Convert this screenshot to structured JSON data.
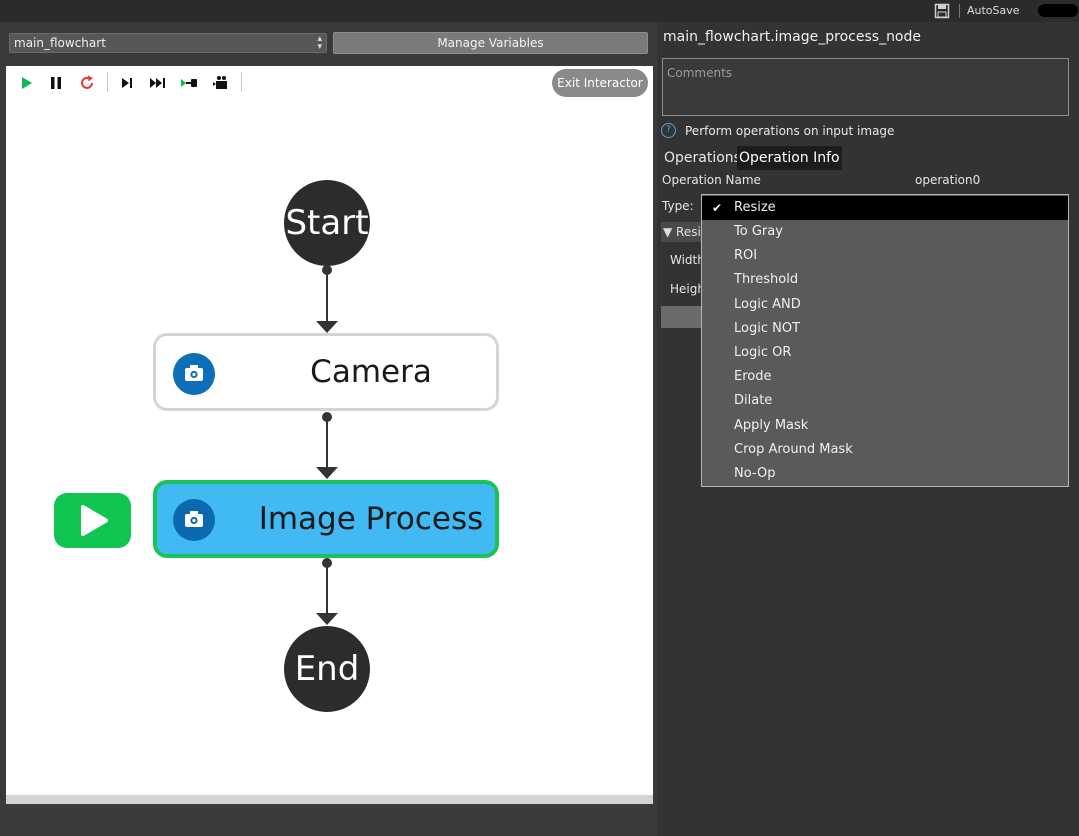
{
  "topbar": {
    "autosave_label": "AutoSave",
    "save_icon": "save-icon"
  },
  "flowchart_select": {
    "value": "main_flowchart"
  },
  "manage_variables_label": "Manage Variables",
  "toolbar": {
    "icons": [
      "play-icon",
      "pause-icon",
      "restart-icon",
      "step-icon",
      "fast-forward-icon",
      "run-to-node-icon",
      "camera-step-icon"
    ],
    "exit_label": "Exit Interactor"
  },
  "flow": {
    "start_label": "Start",
    "camera_label": "Camera",
    "process_label": "Image Process",
    "end_label": "End"
  },
  "colors": {
    "active_node_fill": "#41b9f2",
    "active_node_border": "#19c35a",
    "node_icon": "#0d6fb8",
    "terminal_node": "#2c2c2c"
  },
  "inspector": {
    "title": "main_flowchart.image_process_node",
    "comments_placeholder": "Comments",
    "description": "Perform operations on input image",
    "tabs": [
      "Operations",
      "Operation Info"
    ],
    "active_tab": "Operation Info",
    "operation_name_label": "Operation Name",
    "operation_name_value": "operation0",
    "type_label": "Type:",
    "resize_header": "Resi",
    "width_label": "Width",
    "height_label": "Heigh"
  },
  "type_dropdown": {
    "selected": "Resize",
    "options": [
      "Resize",
      "To Gray",
      "ROI",
      "Threshold",
      "Logic AND",
      "Logic NOT",
      "Logic OR",
      "Erode",
      "Dilate",
      "Apply Mask",
      "Crop Around Mask",
      "No-Op"
    ]
  }
}
